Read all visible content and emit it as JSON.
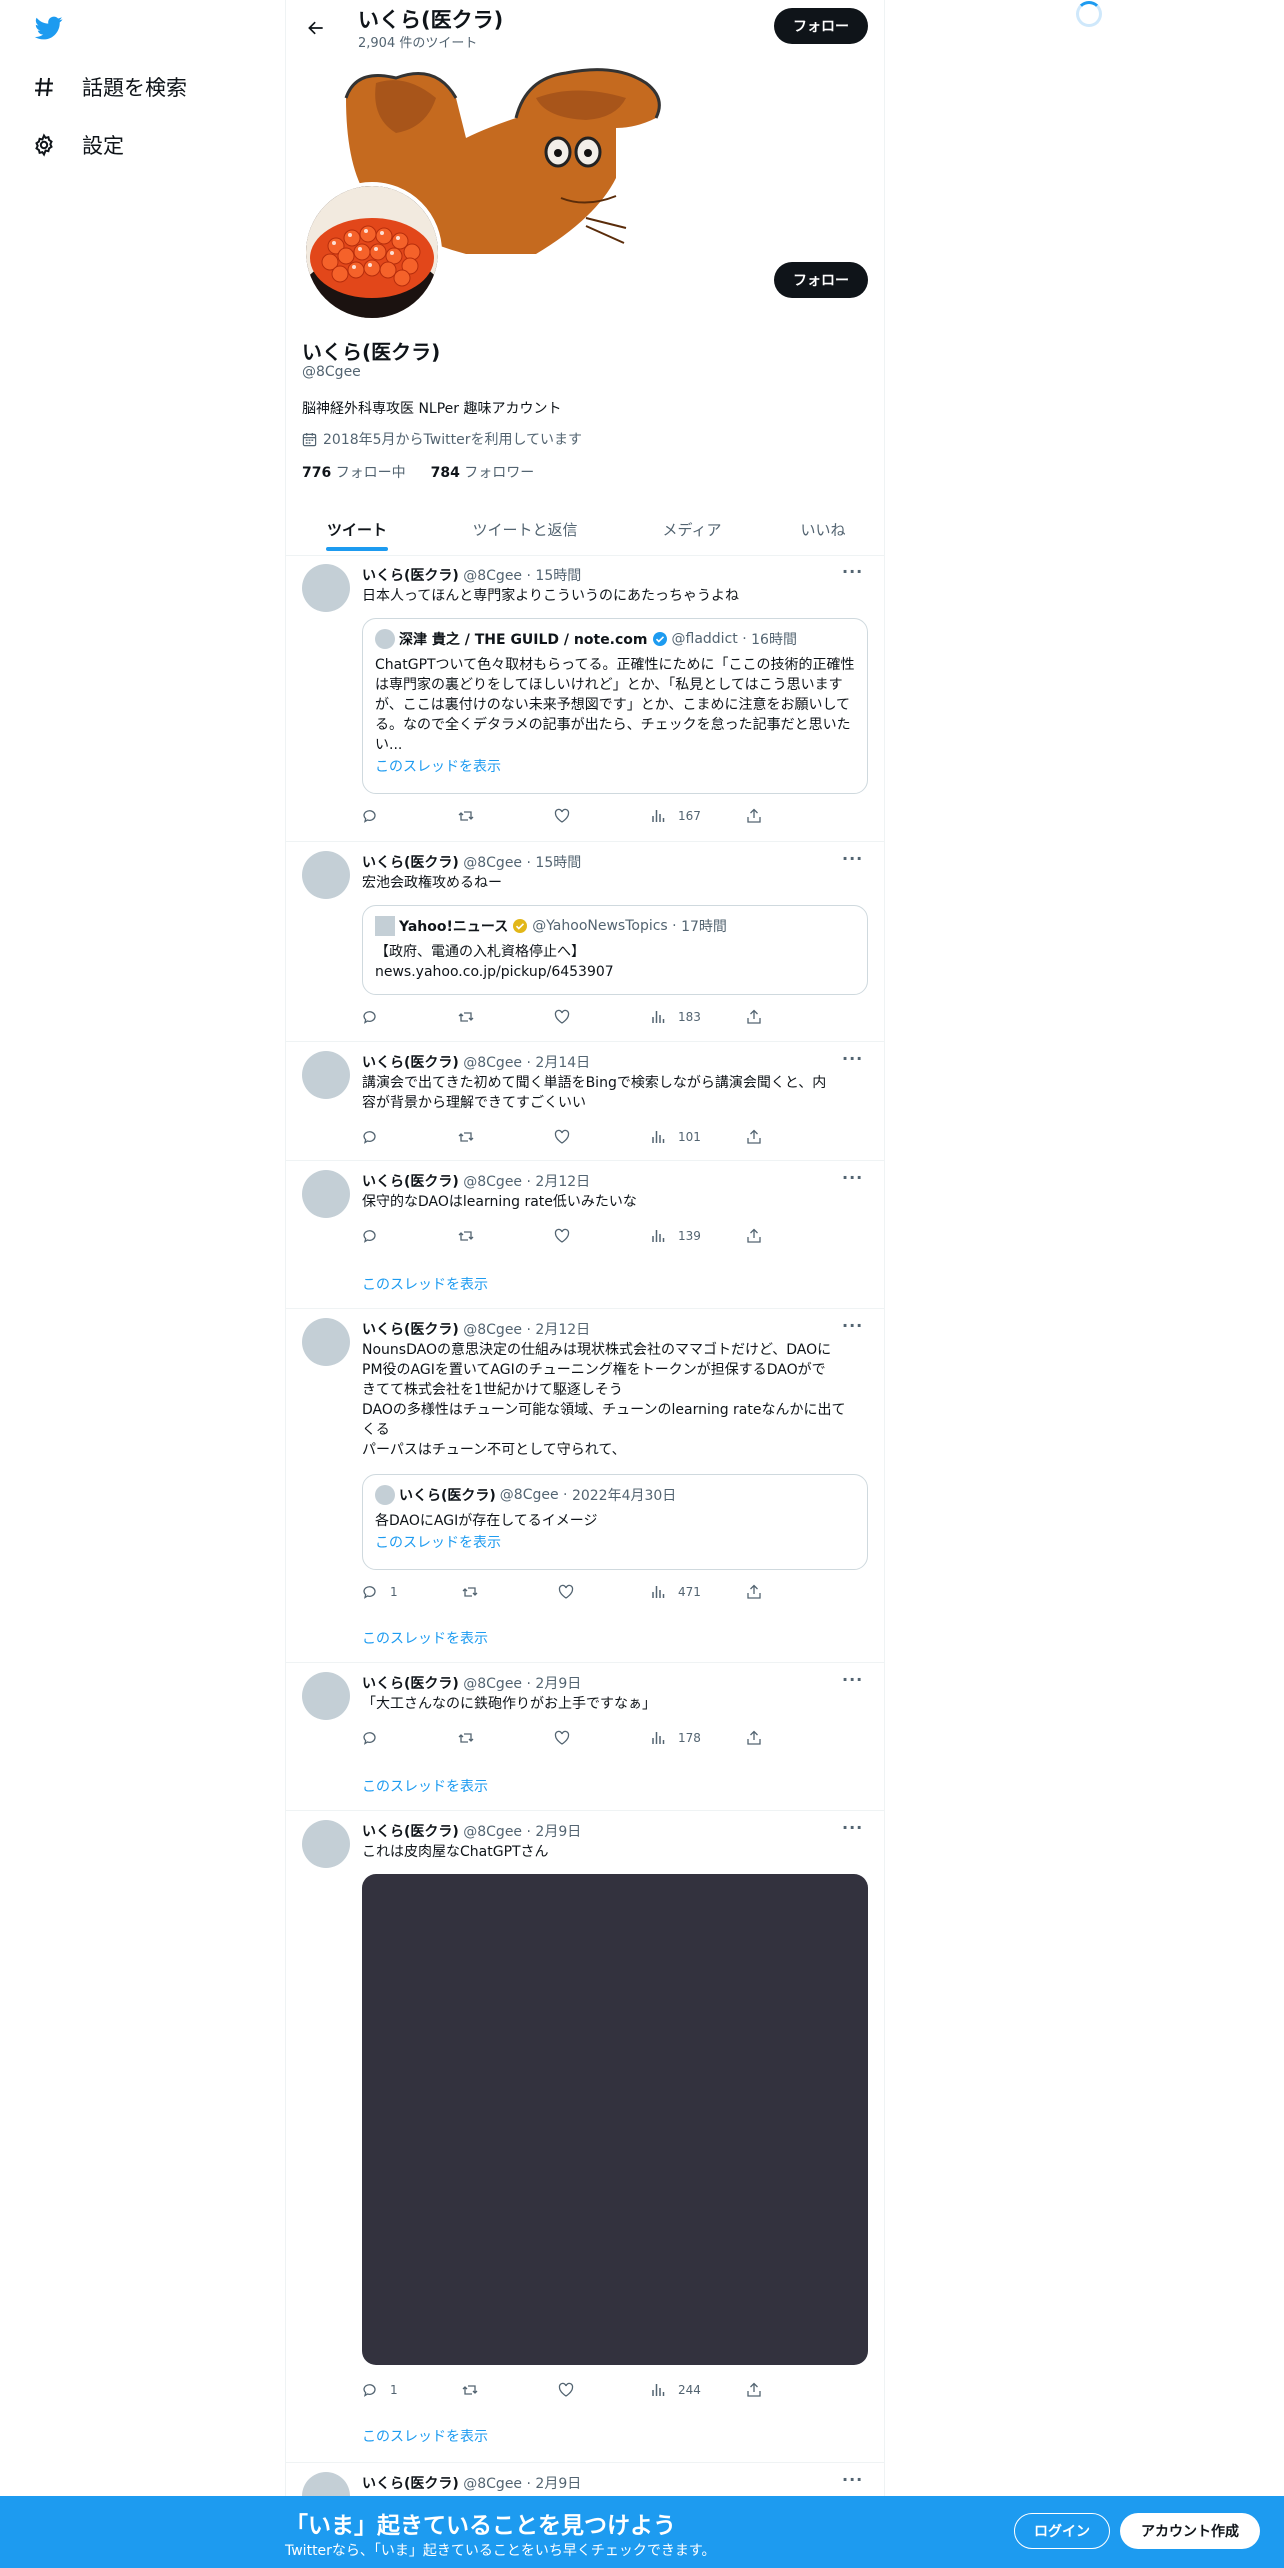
{
  "nav": {
    "items": [
      {
        "label": "話題を検索",
        "icon": "hashtag-icon"
      },
      {
        "label": "設定",
        "icon": "gear-icon"
      }
    ]
  },
  "header": {
    "name": "いくら(医クラ)",
    "tweet_count": "2,904 件のツイート",
    "follow_label": "フォロー"
  },
  "profile": {
    "follow_label": "フォロー",
    "name": "いくら(医クラ)",
    "handle": "@8Cgee",
    "bio": "脳神経外科専攻医 NLPer 趣味アカウント",
    "joined": "2018年5月からTwitterを利用しています",
    "following_count": "776",
    "following_label": "フォロー中",
    "followers_count": "784",
    "followers_label": "フォロワー"
  },
  "tabs": [
    {
      "label": "ツイート",
      "active": true
    },
    {
      "label": "ツイートと返信",
      "active": false
    },
    {
      "label": "メディア",
      "active": false
    },
    {
      "label": "いいね",
      "active": false
    }
  ],
  "tweets": [
    {
      "name": "いくら(医クラ)",
      "handle": "@8Cgee",
      "time": "15時間",
      "text": "日本人ってほんと専門家よりこういうのにあたっちゃうよね",
      "quote": {
        "name": "深津 貴之 / THE GUILD / note.com",
        "handle": "@fladdict",
        "time": "16時間",
        "text": "ChatGPTついて色々取材もらってる。正確性にために「ここの技術的正確性は専門家の裏どりをしてほしいけれど」とか、「私見としてはこう思いますが、ここは裏付けのない未来予想図です」とか、こまめに注意をお願いしてる。なので全くデタラメの記事が出たら、チェックを怠った記事だと思いたい...",
        "show_thread": "このスレッドを表示"
      },
      "reply_count": "",
      "views": "167"
    },
    {
      "name": "いくら(医クラ)",
      "handle": "@8Cgee",
      "time": "15時間",
      "text": "宏池会政権攻めるねー",
      "quote": {
        "name": "Yahoo!ニュース",
        "handle": "@YahooNewsTopics",
        "time": "17時間",
        "line1": "【政府、電通の入札資格停止へ】",
        "line2": "news.yahoo.co.jp/pickup/6453907"
      },
      "views": "183"
    },
    {
      "name": "いくら(医クラ)",
      "handle": "@8Cgee",
      "time": "2月14日",
      "line1": "講演会で出てきた初めて聞く単語をBingで検索しながら講演会聞くと、内",
      "line2": "容が背景から理解できてすごくいい",
      "views": "101"
    },
    {
      "name": "いくら(医クラ)",
      "handle": "@8Cgee",
      "time": "2月12日",
      "text": "保守的なDAOはlearning rate低いみたいな",
      "views": "139",
      "show_thread": "このスレッドを表示"
    },
    {
      "name": "いくら(医クラ)",
      "handle": "@8Cgee",
      "time": "2月12日",
      "lines": [
        "NounsDAOの意思決定の仕組みは現状株式会社のママゴトだけど、DAOに",
        "PM役のAGIを置いてAGIのチューニング権をトークンが担保するDAOがで",
        "きてて株式会社を1世紀かけて駆逐しそう",
        "DAOの多様性はチューン可能な領域、チューンのlearning rateなんかに出て",
        "くる",
        "パーパスはチューン不可として守られて、"
      ],
      "quote": {
        "name": "いくら(医クラ)",
        "handle": "@8Cgee",
        "time": "2022年4月30日",
        "text": "各DAOにAGIが存在してるイメージ",
        "show_thread": "このスレッドを表示"
      },
      "reply_count": "1",
      "views": "471",
      "show_thread": "このスレッドを表示"
    },
    {
      "name": "いくら(医クラ)",
      "handle": "@8Cgee",
      "time": "2月9日",
      "text": "「大工さんなのに鉄砲作りがお上手ですなぁ」",
      "views": "178",
      "show_thread": "このスレッドを表示"
    },
    {
      "name": "いくら(医クラ)",
      "handle": "@8Cgee",
      "time": "2月9日",
      "text": "これは皮肉屋なChatGPTさん",
      "reply_count": "1",
      "views": "244",
      "show_thread": "このスレッドを表示"
    },
    {
      "name": "いくら(医クラ)",
      "handle": "@8Cgee",
      "time": "2月9日"
    }
  ],
  "bottom_banner": {
    "title": "「いま」起きていることを見つけよう",
    "subtitle": "Twitterなら、「いま」起きていることをいち早くチェックできます。",
    "login": "ログイン",
    "signup": "アカウント作成"
  },
  "colors": {
    "accent": "#1d9bf0",
    "text": "#0f1419",
    "muted": "#536471"
  }
}
